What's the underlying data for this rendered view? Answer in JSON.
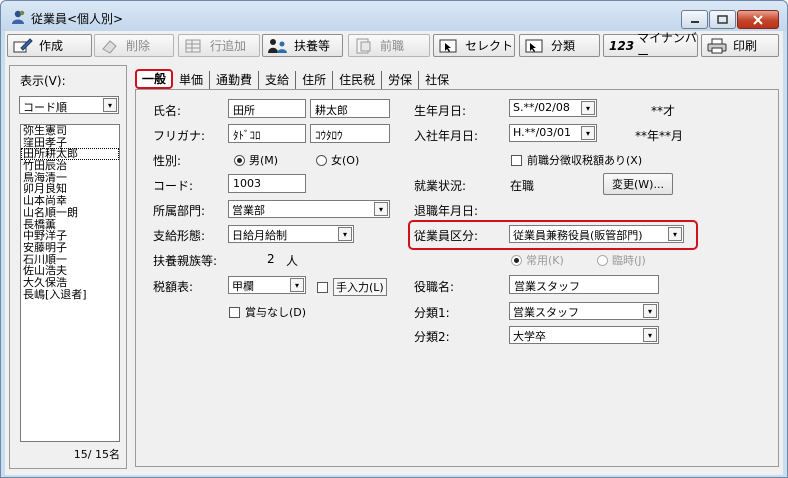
{
  "window": {
    "title": "従業員<個人別>",
    "controls": {
      "minimize": "—",
      "maximize": "□",
      "close": "✕"
    }
  },
  "toolbar": [
    {
      "label": "作成",
      "icon": "edit-icon",
      "enabled": true
    },
    {
      "label": "削除",
      "icon": "eraser-icon",
      "enabled": false
    },
    {
      "label": "行追加",
      "icon": "table-icon",
      "enabled": false
    },
    {
      "label": "扶養等",
      "icon": "family-icon",
      "enabled": true
    },
    {
      "label": "前職",
      "icon": "document-icon",
      "enabled": false
    },
    {
      "label": "セレクト",
      "icon": "select-icon",
      "enabled": true
    },
    {
      "label": "分類",
      "icon": "classify-icon",
      "enabled": true
    },
    {
      "label": "マイナンバー",
      "icon": "mynumber-icon",
      "icon_text": "123",
      "enabled": true
    },
    {
      "label": "印刷",
      "icon": "printer-icon",
      "enabled": true
    }
  ],
  "left_panel": {
    "display_label": "表示(V):",
    "sort_value": "コード順",
    "employees": [
      "弥生憲司",
      "窪田孝子",
      "田所耕太郎",
      "竹田辰治",
      "鳥海清一",
      "卯月良知",
      "山本尚幸",
      "山名順一朗",
      "長橋薫",
      "中野洋子",
      "安藤明子",
      "石川順一",
      "佐山浩夫",
      "大久保浩",
      "長嶋[入退者]"
    ],
    "selected_index": 2,
    "count": "15/  15名"
  },
  "tabs": [
    "一般",
    "単価",
    "通勤費",
    "支給",
    "住所",
    "住民税",
    "労保",
    "社保"
  ],
  "active_tab": 0,
  "form": {
    "name_label": "氏名:",
    "last_name": "田所",
    "first_name": "耕太郎",
    "kana_label": "フリガナ:",
    "last_kana": "ﾀﾄﾞｺﾛ",
    "first_kana": "ｺｳﾀﾛｳ",
    "gender_label": "性別:",
    "gender_male": "男(M)",
    "gender_female": "女(O)",
    "gender_selected": "male",
    "code_label": "コード:",
    "code": "1003",
    "dept_label": "所属部門:",
    "dept": "営業部",
    "pay_label": "支給形態:",
    "pay": "日給月給制",
    "dependents_label": "扶養親族等:",
    "dependents_count": "2",
    "dependents_unit": "人",
    "tax_table_label": "税額表:",
    "tax_table": "甲欄",
    "manual_input": "手入力(L)",
    "no_bonus": "賞与なし(D)",
    "birth_label": "生年月日:",
    "birth": "S.**/02/08",
    "age": "**才",
    "hire_label": "入社年月日:",
    "hire": "H.**/03/01",
    "tenure": "**年**月",
    "prev_tax_check": "前職分徴収税額あり(X)",
    "status_label": "就業状況:",
    "status": "在職",
    "change_button": "変更(W)...",
    "retire_label": "退職年月日:",
    "emp_type_label": "従業員区分:",
    "emp_type": "従業員兼務役員(販管部門)",
    "regular": "常用(K)",
    "temporary": "臨時(J)",
    "position_label": "役職名:",
    "position": "営業スタッフ",
    "class1_label": "分類1:",
    "class1": "営業スタッフ",
    "class2_label": "分類2:",
    "class2": "大学卒"
  }
}
